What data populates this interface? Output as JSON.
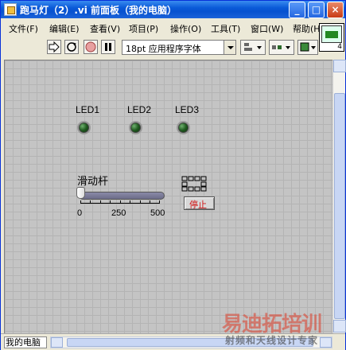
{
  "window": {
    "title": "跑马灯（2）.vi 前面板（我的电脑）",
    "minimize": "_",
    "maximize": "□",
    "close": "×"
  },
  "menu": [
    {
      "label": "文件(F)"
    },
    {
      "label": "编辑(E)"
    },
    {
      "label": "查看(V)"
    },
    {
      "label": "项目(P)"
    },
    {
      "label": "操作(O)"
    },
    {
      "label": "工具(T)"
    },
    {
      "label": "窗口(W)"
    },
    {
      "label": "帮助(H)"
    }
  ],
  "toolbar": {
    "font": "18pt 应用程序字体"
  },
  "vi_icon": {
    "number": "4"
  },
  "panel": {
    "leds": [
      {
        "label": "LED1",
        "state": "off"
      },
      {
        "label": "LED2",
        "state": "off"
      },
      {
        "label": "LED3",
        "state": "off"
      }
    ],
    "slider": {
      "label": "滑动杆",
      "value": 0,
      "min": 0,
      "max": 500,
      "tick_labels": [
        "0",
        "250",
        "500"
      ]
    },
    "stop_button": {
      "label": "停止"
    }
  },
  "status": {
    "target": "我的电脑"
  },
  "watermark": {
    "line1": "易迪拓培训",
    "line2": "射频和天线设计专家"
  },
  "colors": {
    "panel_bg": "#c4c4c4",
    "led_off": "#1f5a1f",
    "stop_text": "#d01010",
    "title_bar": "#0a5ad8"
  }
}
